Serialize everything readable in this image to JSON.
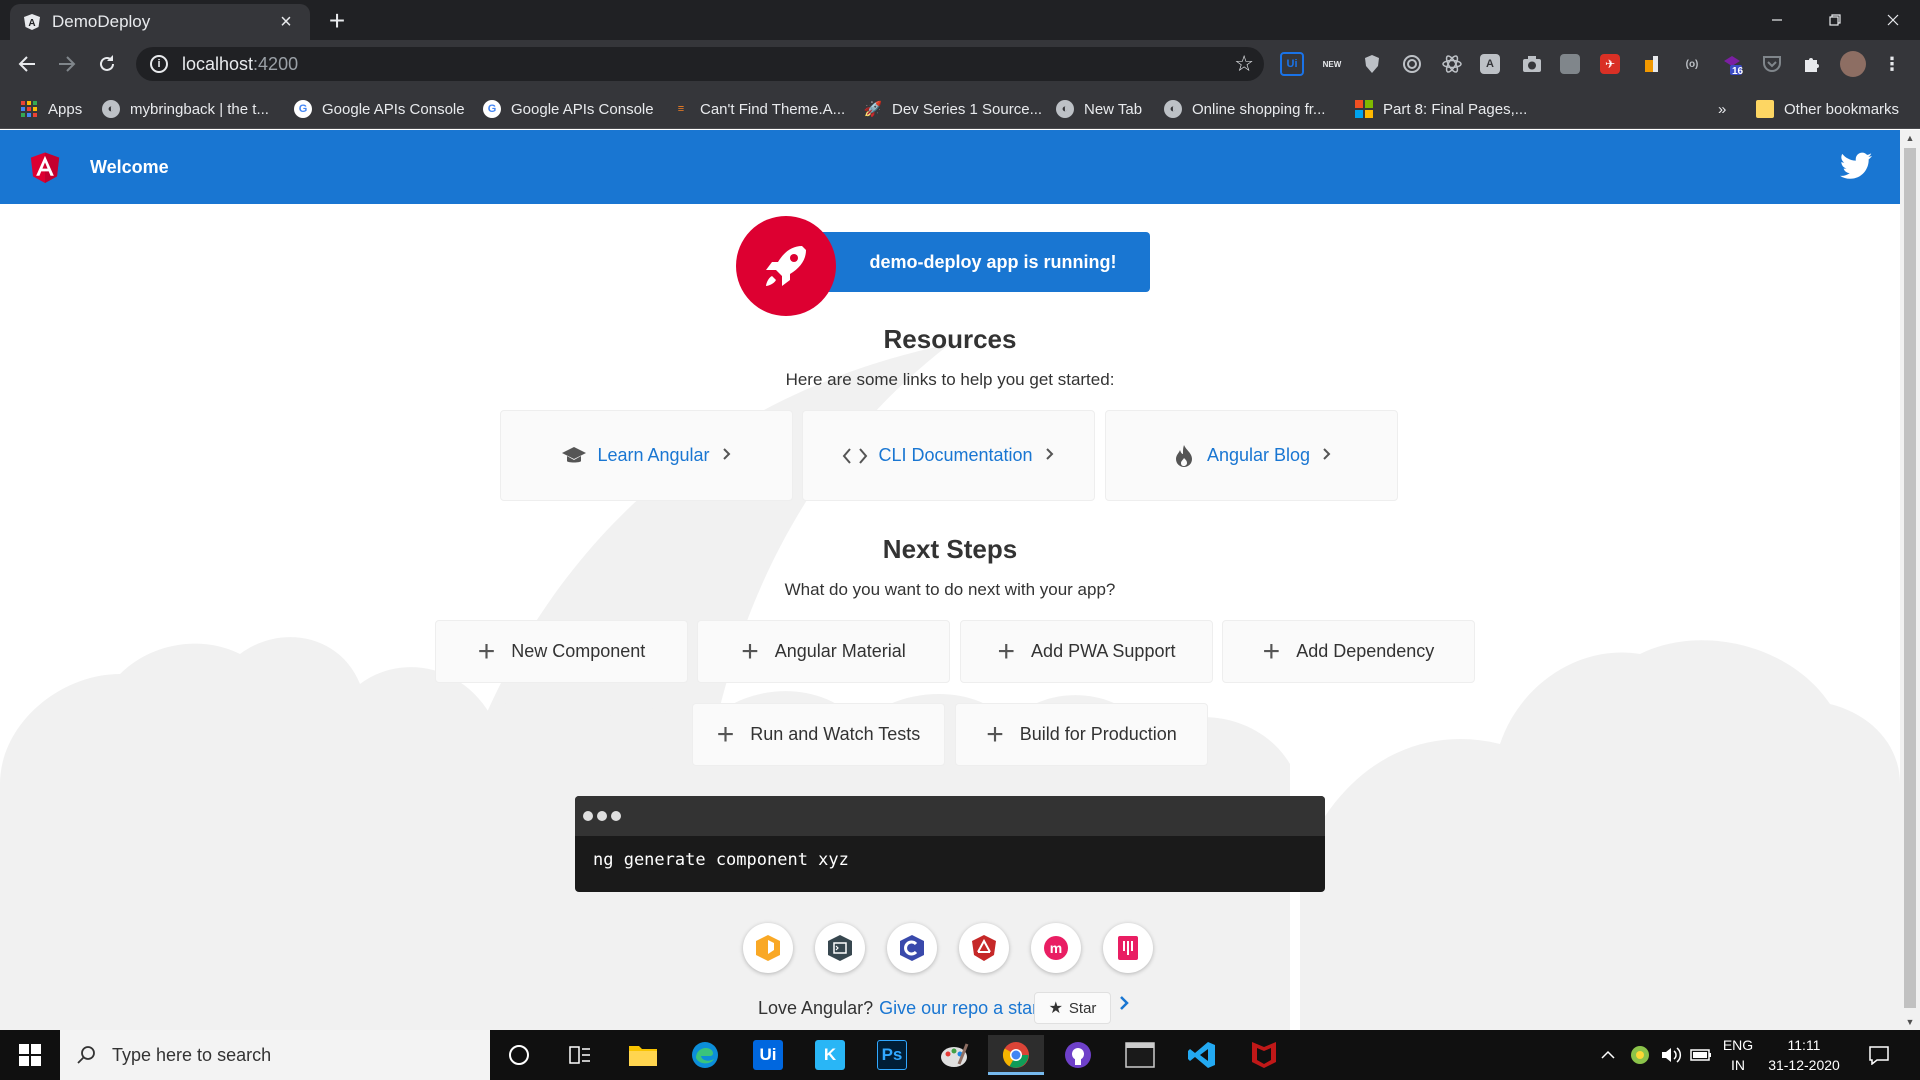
{
  "browser": {
    "tab_title": "DemoDeploy",
    "url_host": "localhost",
    "url_port": ":4200",
    "bookmarks": [
      {
        "label": "Apps",
        "icon": "apps-grid-icon"
      },
      {
        "label": "mybringback | the t...",
        "icon": "globe-icon"
      },
      {
        "label": "Google APIs Console",
        "icon": "google-icon"
      },
      {
        "label": "Google APIs Console",
        "icon": "google-icon"
      },
      {
        "label": "Can't Find Theme.A...",
        "icon": "stackoverflow-icon"
      },
      {
        "label": "Dev Series 1 Source...",
        "icon": "rocket-icon"
      },
      {
        "label": "New Tab",
        "icon": "globe-icon"
      },
      {
        "label": "Online shopping fr...",
        "icon": "globe-icon"
      },
      {
        "label": "Part 8: Final Pages,...",
        "icon": "microsoft-icon"
      }
    ],
    "overflow": "»",
    "other_bookmarks": "Other bookmarks",
    "extension_badge": "16"
  },
  "app": {
    "toolbar_title": "Welcome",
    "running_text": "demo-deploy app is running!",
    "resources_title": "Resources",
    "resources_sub": "Here are some links to help you get started:",
    "resources": [
      {
        "label": "Learn Angular",
        "icon": "graduation-cap-icon"
      },
      {
        "label": "CLI Documentation",
        "icon": "code-brackets-icon"
      },
      {
        "label": "Angular Blog",
        "icon": "flame-icon"
      }
    ],
    "next_title": "Next Steps",
    "next_sub": "What do you want to do next with your app?",
    "steps": [
      "New Component",
      "Angular Material",
      "Add PWA Support",
      "Add Dependency",
      "Run and Watch Tests",
      "Build for Production"
    ],
    "terminal_command": "ng generate component xyz",
    "love_text": "Love Angular?",
    "love_link": "Give our repo a star.",
    "star_label": "Star"
  },
  "taskbar": {
    "search_placeholder": "Type here to search",
    "lang_top": "ENG",
    "lang_bottom": "IN",
    "time": "11:11",
    "date": "31-12-2020"
  },
  "colors": {
    "angular_blue": "#1976d2",
    "angular_red": "#dd0031"
  }
}
